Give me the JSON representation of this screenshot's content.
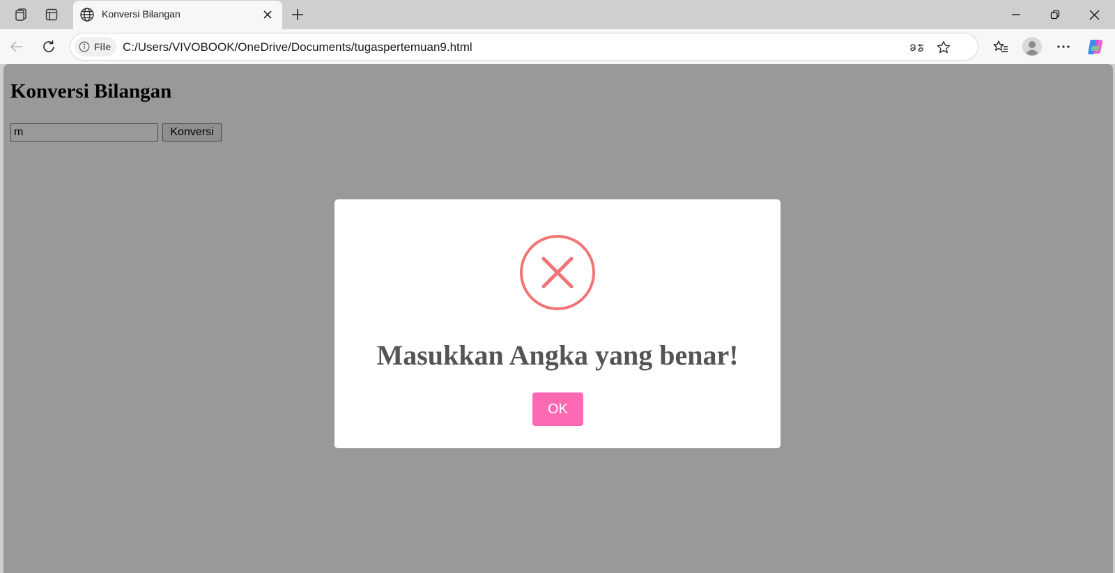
{
  "browser": {
    "tab": {
      "title": "Konversi Bilangan"
    },
    "address_bar": {
      "scheme_label": "File",
      "url": "C:/Users/VIVOBOOK/OneDrive/Documents/tugaspertemuan9.html"
    }
  },
  "page": {
    "heading": "Konversi Bilangan",
    "number_input": {
      "value": "m"
    },
    "convert_button": "Konversi"
  },
  "dialog": {
    "icon": "error-x-circle-icon",
    "message": "Masukkan Angka yang benar!",
    "ok_button": "OK"
  },
  "colors": {
    "error_icon": "#f27474",
    "ok_button": "#ff69b4",
    "message_text": "#545454",
    "overlay": "rgba(0,0,0,0.4)"
  }
}
